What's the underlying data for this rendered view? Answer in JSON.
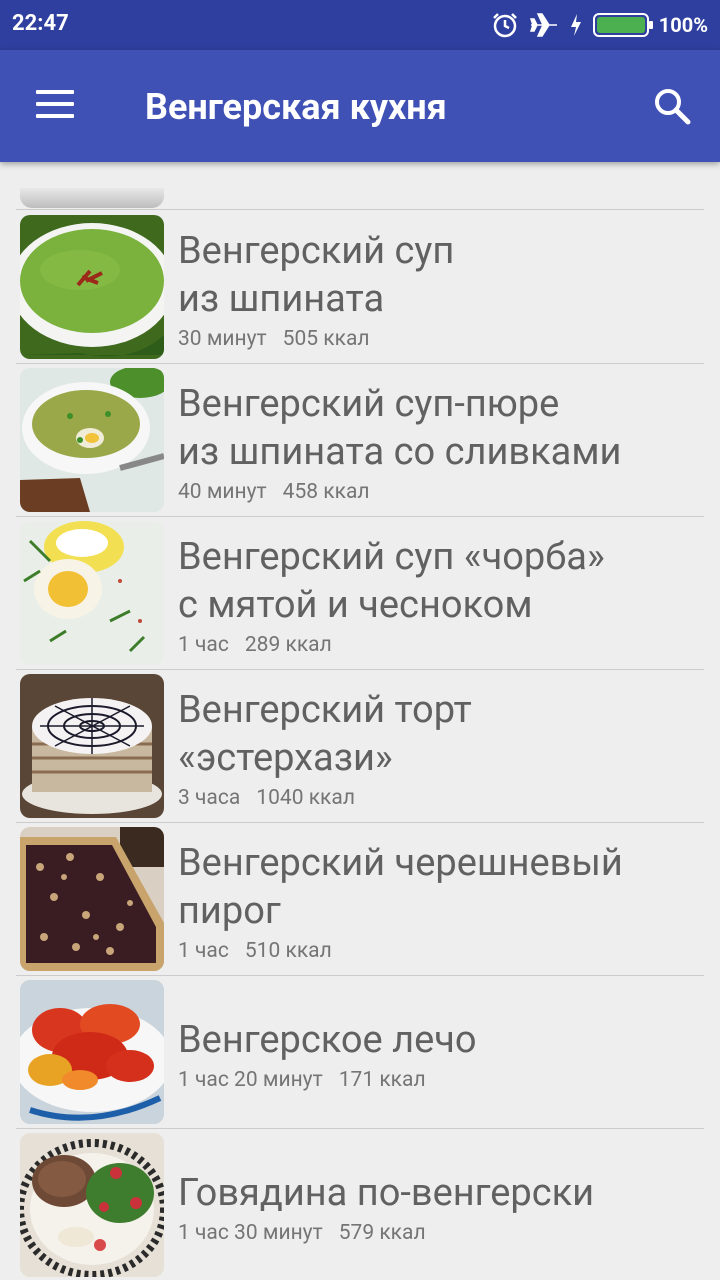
{
  "status_bar": {
    "time": "22:47",
    "battery": "100%",
    "icons": [
      "alarm-icon",
      "airplane-mode-icon",
      "charging-icon",
      "battery-icon"
    ]
  },
  "app_bar": {
    "title": "Венгерская кухня",
    "menu_icon": "menu-icon",
    "search_icon": "search-icon"
  },
  "recipes": [
    {
      "title": "Венгерский суп\nиз шпината",
      "time": "30 минут",
      "kcal": "505 ккал",
      "image": "spinach-soup"
    },
    {
      "title": "Венгерский суп-пюре\nиз шпината со сливками",
      "time": "40 минут",
      "kcal": "458 ккал",
      "image": "spinach-cream-soup"
    },
    {
      "title": "Венгерский суп «чорба»\nс мятой и чесноком",
      "time": "1 час",
      "kcal": "289 ккал",
      "image": "ciorba-soup"
    },
    {
      "title": "Венгерский торт\n«эстерхази»",
      "time": "3 часа",
      "kcal": "1040 ккал",
      "image": "esterhazy-cake"
    },
    {
      "title": "Венгерский черешневый\nпирог",
      "time": "1 час",
      "kcal": "510 ккал",
      "image": "cherry-pie"
    },
    {
      "title": "Венгерское лечо",
      "time": "1 час 20 минут",
      "kcal": "171 ккал",
      "image": "lecho"
    },
    {
      "title": "Говядина по-венгерски",
      "time": "1 час 30 минут",
      "kcal": "579 ккал",
      "image": "hungarian-beef"
    }
  ]
}
